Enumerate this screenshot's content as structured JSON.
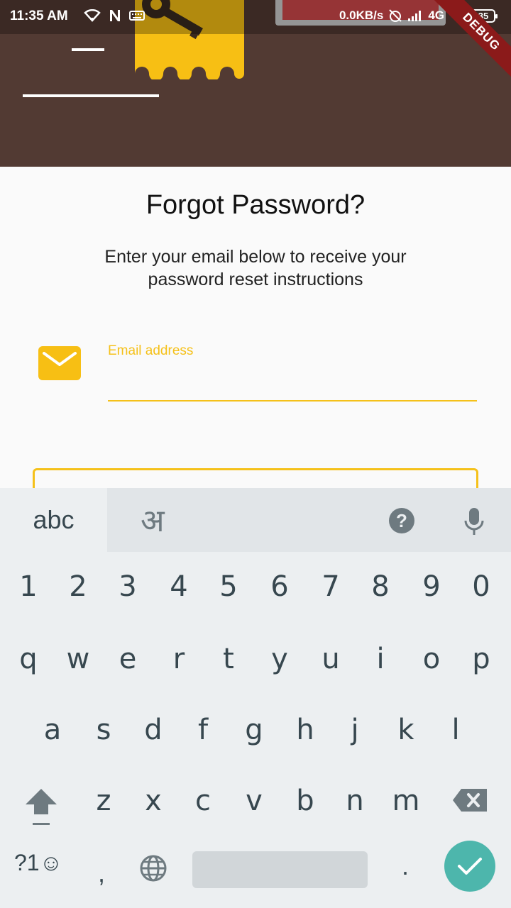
{
  "status_bar": {
    "time": "11:35 AM",
    "network_speed": "0.0KB/s",
    "network_type": "4G",
    "battery": "35"
  },
  "debug_banner": "DEBUG",
  "forgot": {
    "title": "Forgot Password?",
    "subtitle": "Enter your email below to receive your password reset instructions",
    "email_label": "Email address",
    "email_value": ""
  },
  "colors": {
    "header": "#523a33",
    "accent": "#f5c11a",
    "enter_key": "#4db6ac"
  },
  "keyboard": {
    "mode_label": "abc",
    "alt_lang_label": "अ",
    "help_label": "?",
    "number_row": [
      "1",
      "2",
      "3",
      "4",
      "5",
      "6",
      "7",
      "8",
      "9",
      "0"
    ],
    "row1": [
      "q",
      "w",
      "e",
      "r",
      "t",
      "y",
      "u",
      "i",
      "o",
      "p"
    ],
    "row2": [
      "a",
      "s",
      "d",
      "f",
      "g",
      "h",
      "j",
      "k",
      "l"
    ],
    "row3": [
      "z",
      "x",
      "c",
      "v",
      "b",
      "n",
      "m"
    ],
    "symbols_label": "?1☺",
    "comma": ",",
    "period": "."
  }
}
